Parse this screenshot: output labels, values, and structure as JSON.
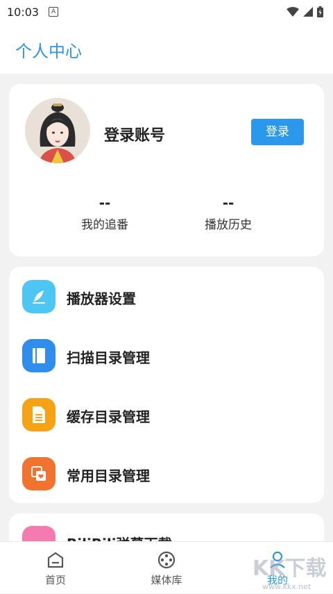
{
  "status_bar": {
    "time": "10:03"
  },
  "header": {
    "title": "个人中心"
  },
  "profile": {
    "login_title": "登录账号",
    "login_button": "登录",
    "stats": [
      {
        "value": "--",
        "label": "我的追番"
      },
      {
        "value": "--",
        "label": "播放历史"
      }
    ]
  },
  "menu": {
    "items": [
      {
        "label": "播放器设置",
        "icon": "pen-icon",
        "color": "#4ec6f4"
      },
      {
        "label": "扫描目录管理",
        "icon": "book-icon",
        "color": "#2f8deb"
      },
      {
        "label": "缓存目录管理",
        "icon": "document-icon",
        "color": "#f5a314"
      },
      {
        "label": "常用目录管理",
        "icon": "heart-folder-icon",
        "color": "#f07430"
      }
    ]
  },
  "peek_item": {
    "label": "BiliBili弹幕下载"
  },
  "bottom_nav": [
    {
      "label": "首页",
      "icon": "home-icon"
    },
    {
      "label": "媒体库",
      "icon": "film-reel-icon"
    },
    {
      "label": "我的",
      "icon": "user-icon",
      "active": true
    }
  ],
  "watermark": {
    "text": "KK下载",
    "url": "www.kkx.net"
  },
  "colors": {
    "accent": "#2d95e4",
    "button": "#2b98eb",
    "background": "#f2f2f2"
  }
}
